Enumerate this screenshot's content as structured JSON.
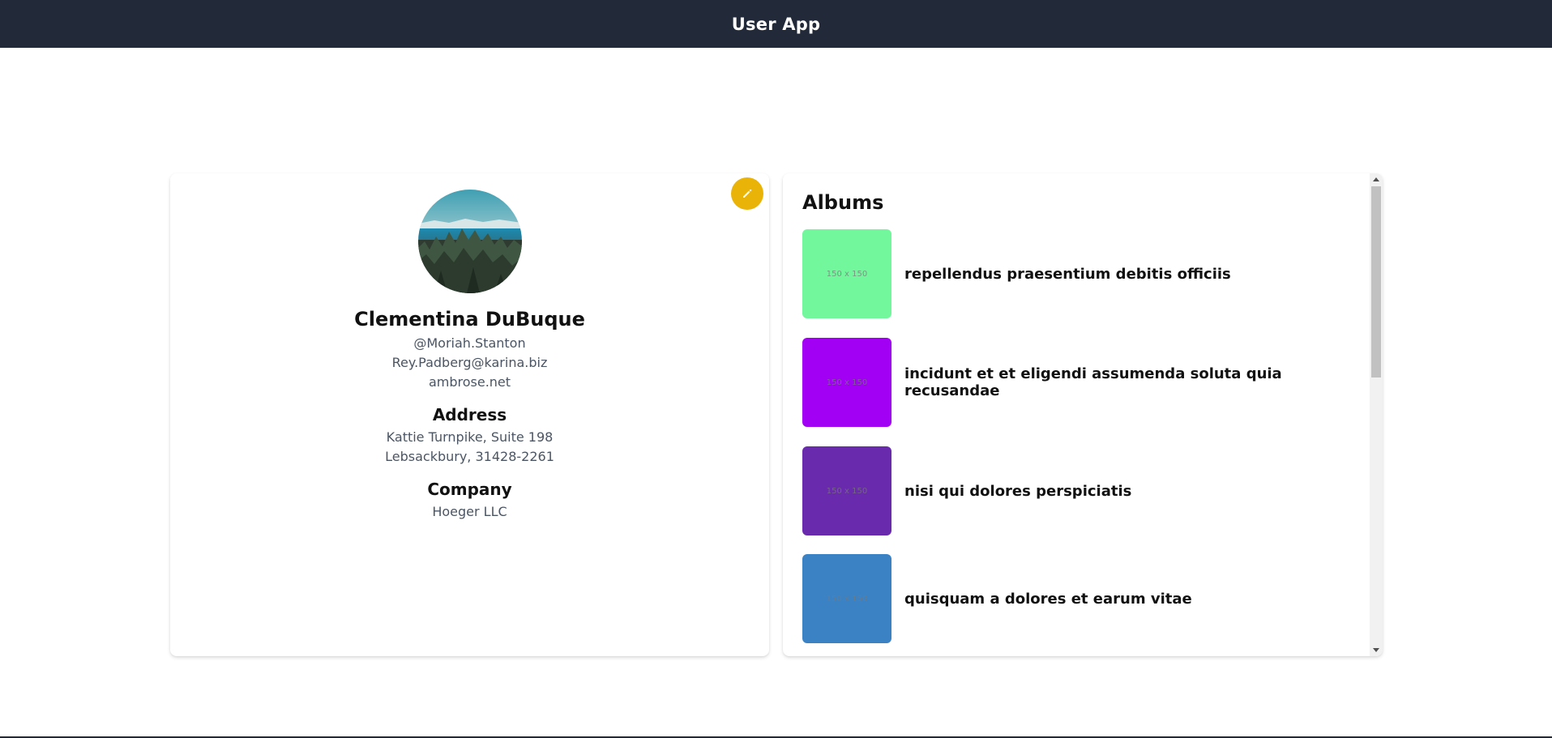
{
  "app": {
    "title": "User App"
  },
  "profile": {
    "name": "Clementina DuBuque",
    "username": "@Moriah.Stanton",
    "email": "Rey.Padberg@karina.biz",
    "website": "ambrose.net",
    "address_heading": "Address",
    "address_line1": "Kattie Turnpike, Suite 198",
    "address_line2": "Lebsackbury, 31428-2261",
    "company_heading": "Company",
    "company_name": "Hoeger LLC",
    "edit_icon": "pencil-icon",
    "edit_color": "#eab308"
  },
  "albums": {
    "heading": "Albums",
    "items": [
      {
        "title": "repellendus praesentium debitis officiis",
        "thumb_label": "150 x 150",
        "color": "#72f79c"
      },
      {
        "title": "incidunt et et eligendi assumenda soluta quia recusandae",
        "thumb_label": "150 x 150",
        "color": "#a100f5"
      },
      {
        "title": "nisi qui dolores perspiciatis",
        "thumb_label": "150 x 150",
        "color": "#6a2aae"
      },
      {
        "title": "quisquam a dolores et earum vitae",
        "thumb_label": "150 x 150",
        "color": "#3b82c4"
      }
    ]
  },
  "colors": {
    "header_bg": "#222a3a"
  }
}
